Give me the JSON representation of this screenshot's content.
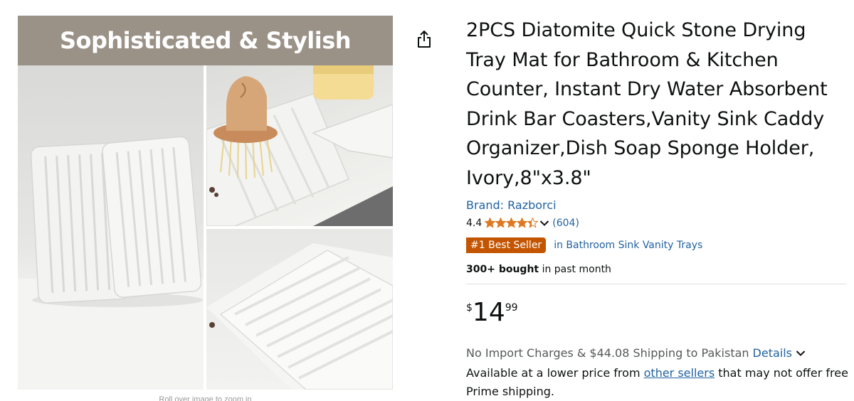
{
  "image": {
    "banner_text": "Sophisticated & Stylish",
    "caption": "Roll over image to zoom in"
  },
  "share": {
    "icon": "share-icon"
  },
  "product": {
    "title": "2PCS Diatomite Quick Stone Drying Tray Mat for Bathroom & Kitchen Counter, Instant Dry Water Absorbent Drink Bar Coasters,Vanity Sink Caddy Organizer,Dish Soap Sponge Holder, Ivory,8\"x3.8\"",
    "brand": "Brand: Razborci",
    "rating": {
      "value_text": "4.4",
      "value": 4.4,
      "max": 5,
      "review_count": "(604)"
    },
    "bestseller": {
      "badge": "#1 Best Seller",
      "category": "in Bathroom Sink Vanity Trays"
    },
    "bought": {
      "count": "300+ bought",
      "suffix": " in past month"
    },
    "price": {
      "symbol": "$",
      "whole": "14",
      "fraction": "99"
    },
    "shipping": {
      "text": "No Import Charges & $44.08 Shipping to Pakistan",
      "details_label": "Details"
    },
    "lower_price": {
      "prefix": "Available at a lower price from ",
      "link": "other sellers",
      "suffix": " that may not offer free Prime shipping."
    }
  },
  "colors": {
    "link": "#2162a1",
    "bestseller_badge": "#c45500",
    "star": "#de7921",
    "banner": "#9a9187"
  }
}
